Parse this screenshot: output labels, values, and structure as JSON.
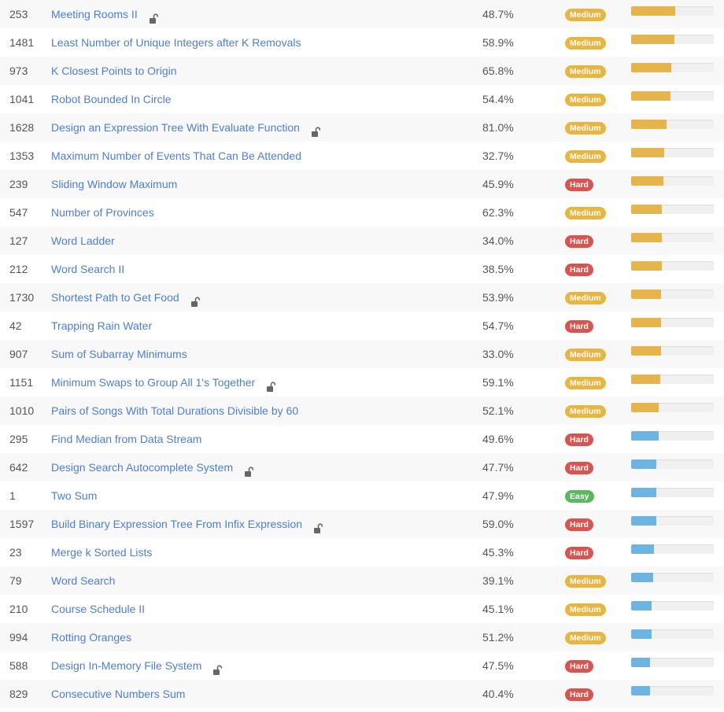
{
  "colors": {
    "Medium": "#e8b540",
    "Hard": "#d9534f",
    "Easy": "#5cb85c",
    "bar_warm": "#e6b44c",
    "bar_cool": "#6db5e0",
    "lock": "#666666"
  },
  "icons": {
    "lock": "unlocked-padlock-icon"
  },
  "rows": [
    {
      "id": "253",
      "title": "Meeting Rooms II",
      "lock": true,
      "acceptance": "48.7%",
      "difficulty": "Medium",
      "frequency": 0.53,
      "bar_color": "bar_warm"
    },
    {
      "id": "1481",
      "title": "Least Number of Unique Integers after K Removals",
      "lock": false,
      "acceptance": "58.9%",
      "difficulty": "Medium",
      "frequency": 0.52,
      "bar_color": "bar_warm"
    },
    {
      "id": "973",
      "title": "K Closest Points to Origin",
      "lock": false,
      "acceptance": "65.8%",
      "difficulty": "Medium",
      "frequency": 0.49,
      "bar_color": "bar_warm"
    },
    {
      "id": "1041",
      "title": "Robot Bounded In Circle",
      "lock": false,
      "acceptance": "54.4%",
      "difficulty": "Medium",
      "frequency": 0.48,
      "bar_color": "bar_warm"
    },
    {
      "id": "1628",
      "title": "Design an Expression Tree With Evaluate Function",
      "lock": true,
      "acceptance": "81.0%",
      "difficulty": "Medium",
      "frequency": 0.43,
      "bar_color": "bar_warm"
    },
    {
      "id": "1353",
      "title": "Maximum Number of Events That Can Be Attended",
      "lock": false,
      "acceptance": "32.7%",
      "difficulty": "Medium",
      "frequency": 0.4,
      "bar_color": "bar_warm"
    },
    {
      "id": "239",
      "title": "Sliding Window Maximum",
      "lock": false,
      "acceptance": "45.9%",
      "difficulty": "Hard",
      "frequency": 0.39,
      "bar_color": "bar_warm"
    },
    {
      "id": "547",
      "title": "Number of Provinces",
      "lock": false,
      "acceptance": "62.3%",
      "difficulty": "Medium",
      "frequency": 0.37,
      "bar_color": "bar_warm"
    },
    {
      "id": "127",
      "title": "Word Ladder",
      "lock": false,
      "acceptance": "34.0%",
      "difficulty": "Hard",
      "frequency": 0.37,
      "bar_color": "bar_warm"
    },
    {
      "id": "212",
      "title": "Word Search II",
      "lock": false,
      "acceptance": "38.5%",
      "difficulty": "Hard",
      "frequency": 0.37,
      "bar_color": "bar_warm"
    },
    {
      "id": "1730",
      "title": "Shortest Path to Get Food",
      "lock": true,
      "acceptance": "53.9%",
      "difficulty": "Medium",
      "frequency": 0.36,
      "bar_color": "bar_warm"
    },
    {
      "id": "42",
      "title": "Trapping Rain Water",
      "lock": false,
      "acceptance": "54.7%",
      "difficulty": "Hard",
      "frequency": 0.36,
      "bar_color": "bar_warm"
    },
    {
      "id": "907",
      "title": "Sum of Subarray Minimums",
      "lock": false,
      "acceptance": "33.0%",
      "difficulty": "Medium",
      "frequency": 0.36,
      "bar_color": "bar_warm"
    },
    {
      "id": "1151",
      "title": "Minimum Swaps to Group All 1's Together",
      "lock": true,
      "acceptance": "59.1%",
      "difficulty": "Medium",
      "frequency": 0.35,
      "bar_color": "bar_warm"
    },
    {
      "id": "1010",
      "title": "Pairs of Songs With Total Durations Divisible by 60",
      "lock": false,
      "acceptance": "52.1%",
      "difficulty": "Medium",
      "frequency": 0.33,
      "bar_color": "bar_warm"
    },
    {
      "id": "295",
      "title": "Find Median from Data Stream",
      "lock": false,
      "acceptance": "49.6%",
      "difficulty": "Hard",
      "frequency": 0.33,
      "bar_color": "bar_cool"
    },
    {
      "id": "642",
      "title": "Design Search Autocomplete System",
      "lock": true,
      "acceptance": "47.7%",
      "difficulty": "Hard",
      "frequency": 0.3,
      "bar_color": "bar_cool"
    },
    {
      "id": "1",
      "title": "Two Sum",
      "lock": false,
      "acceptance": "47.9%",
      "difficulty": "Easy",
      "frequency": 0.3,
      "bar_color": "bar_cool"
    },
    {
      "id": "1597",
      "title": "Build Binary Expression Tree From Infix Expression",
      "lock": true,
      "acceptance": "59.0%",
      "difficulty": "Hard",
      "frequency": 0.3,
      "bar_color": "bar_cool"
    },
    {
      "id": "23",
      "title": "Merge k Sorted Lists",
      "lock": false,
      "acceptance": "45.3%",
      "difficulty": "Hard",
      "frequency": 0.28,
      "bar_color": "bar_cool"
    },
    {
      "id": "79",
      "title": "Word Search",
      "lock": false,
      "acceptance": "39.1%",
      "difficulty": "Medium",
      "frequency": 0.27,
      "bar_color": "bar_cool"
    },
    {
      "id": "210",
      "title": "Course Schedule II",
      "lock": false,
      "acceptance": "45.1%",
      "difficulty": "Medium",
      "frequency": 0.25,
      "bar_color": "bar_cool"
    },
    {
      "id": "994",
      "title": "Rotting Oranges",
      "lock": false,
      "acceptance": "51.2%",
      "difficulty": "Medium",
      "frequency": 0.25,
      "bar_color": "bar_cool"
    },
    {
      "id": "588",
      "title": "Design In-Memory File System",
      "lock": true,
      "acceptance": "47.5%",
      "difficulty": "Hard",
      "frequency": 0.23,
      "bar_color": "bar_cool"
    },
    {
      "id": "829",
      "title": "Consecutive Numbers Sum",
      "lock": false,
      "acceptance": "40.4%",
      "difficulty": "Hard",
      "frequency": 0.23,
      "bar_color": "bar_cool"
    }
  ]
}
